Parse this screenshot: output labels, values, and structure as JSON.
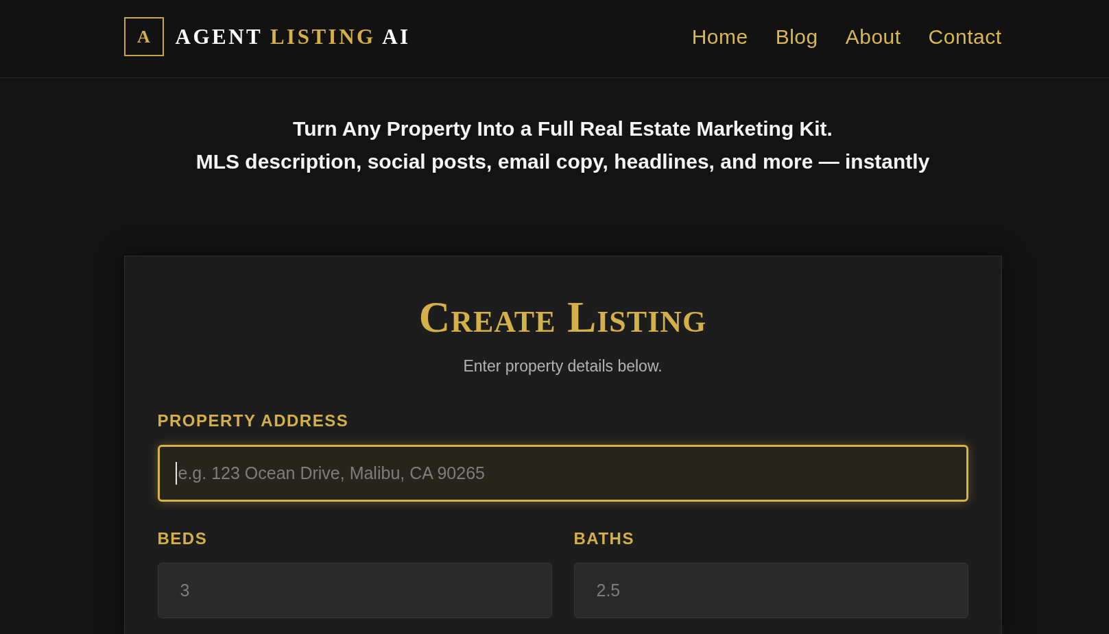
{
  "header": {
    "logo": {
      "mark": "A",
      "words": [
        {
          "text": "AGENT",
          "accent": false
        },
        {
          "text": "LISTING",
          "accent": true
        },
        {
          "text": "AI",
          "accent": false
        }
      ]
    },
    "nav": [
      {
        "label": "Home"
      },
      {
        "label": "Blog"
      },
      {
        "label": "About"
      },
      {
        "label": "Contact"
      }
    ]
  },
  "hero": {
    "lines": [
      "Turn Any Property Into a Full Real Estate Marketing Kit.",
      "MLS description, social posts, email copy, headlines, and more — instantly"
    ]
  },
  "form": {
    "title": "Create Listing",
    "subtitle": "Enter property details below.",
    "rows": [
      {
        "fields": [
          {
            "label": "PROPERTY ADDRESS",
            "placeholder": "e.g. 123 Ocean Drive, Malibu, CA 90265",
            "focused": true
          }
        ]
      },
      {
        "fields": [
          {
            "label": "BEDS",
            "placeholder": "3",
            "focused": false
          },
          {
            "label": "BATHS",
            "placeholder": "2.5",
            "focused": false
          }
        ]
      }
    ]
  }
}
